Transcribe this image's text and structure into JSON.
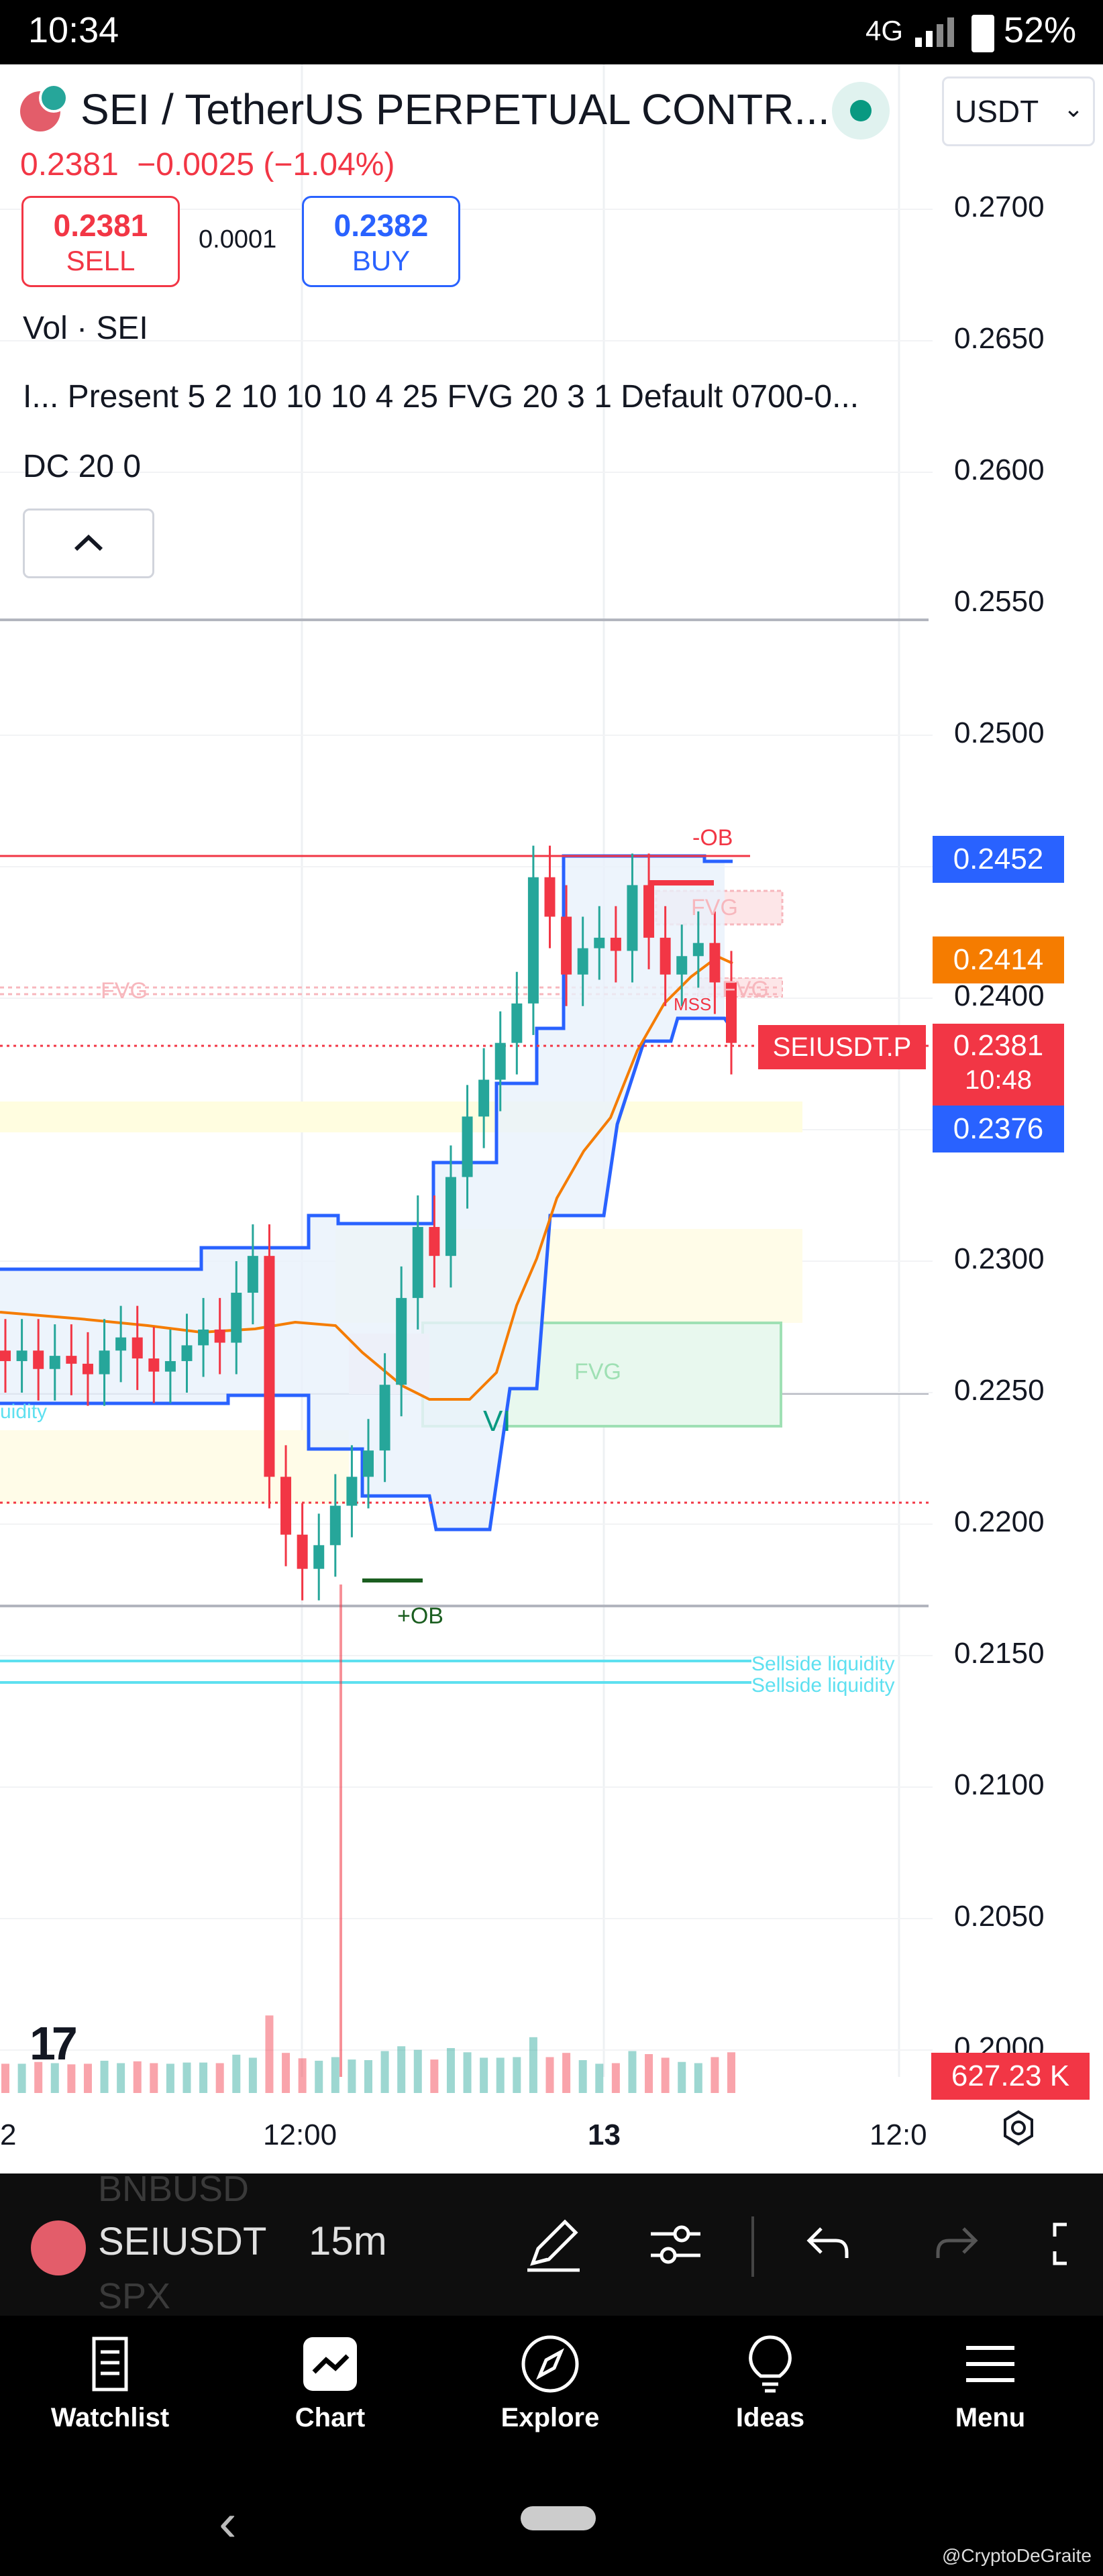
{
  "status_bar": {
    "time": "10:34",
    "network": "4G",
    "battery": "52%"
  },
  "header": {
    "title": "SEI / TetherUS PERPETUAL CONTR...",
    "currency_select": "USDT",
    "last_price": "0.2381",
    "change": "−0.0025 (−1.04%)",
    "sell": {
      "price": "0.2381",
      "label": "SELL"
    },
    "buy": {
      "price": "0.2382",
      "label": "BUY"
    },
    "spread": "0.0001"
  },
  "legend": {
    "volume": "Vol · SEI",
    "indicator": "I...  Present 5 2 10 10 10 4 25 FVG 20 3 1 Default 0700-0...",
    "donchian": "DC 20 0"
  },
  "colors": {
    "up": "#26a69a",
    "down": "#f23645",
    "accent": "#2962ff",
    "orange": "#f57c00"
  },
  "chart_data": {
    "type": "candlestick",
    "symbol": "SEIUSDT.P",
    "interval": "15m",
    "y_ticks": [
      "0.2700",
      "0.2650",
      "0.2600",
      "0.2550",
      "0.2500",
      "0.2400",
      "0.2300",
      "0.2250",
      "0.2200",
      "0.2150",
      "0.2100",
      "0.2050",
      "0.2000"
    ],
    "x_ticks": [
      "2",
      "12:00",
      "13",
      "12:0"
    ],
    "ylim": [
      0.2,
      0.27
    ],
    "price_labels": {
      "dc_upper": "0.2452",
      "ema": "0.2414",
      "symbol_tag": "SEIUSDT.P",
      "last_price": "0.2381",
      "countdown": "10:48",
      "dc_lower": "0.2376",
      "volume": "627.23 K"
    },
    "annotations": [
      "-OB",
      "FVG",
      "FVG",
      "FVG",
      "MSS",
      "FVG",
      "VI",
      "+OB",
      "Sellside liquidity",
      "Sellside liquidity",
      "uidity"
    ],
    "series": [
      {
        "name": "close (approx)",
        "values": [
          0.2262,
          0.2266,
          0.2259,
          0.2264,
          0.2261,
          0.2257,
          0.2266,
          0.2271,
          0.2263,
          0.2258,
          0.2262,
          0.2268,
          0.2274,
          0.2269,
          0.2288,
          0.2302,
          0.2218,
          0.2196,
          0.2183,
          0.2192,
          0.2207,
          0.2218,
          0.2228,
          0.2253,
          0.2286,
          0.2313,
          0.2302,
          0.2332,
          0.2355,
          0.2369,
          0.2383,
          0.2398,
          0.2446,
          0.2431,
          0.2409,
          0.2419,
          0.2423,
          0.2418,
          0.2443,
          0.2423,
          0.2409,
          0.2416,
          0.2421,
          0.2406,
          0.2383
        ]
      }
    ]
  },
  "toolbar": {
    "symbol": "SEIUSDT",
    "interval": "15m",
    "ghost_above": "BNBUSD",
    "ghost_below": "SPX"
  },
  "nav": [
    {
      "label": "Watchlist"
    },
    {
      "label": "Chart"
    },
    {
      "label": "Explore"
    },
    {
      "label": "Ideas"
    },
    {
      "label": "Menu"
    }
  ],
  "watermark": "@CryptoDeGraite"
}
